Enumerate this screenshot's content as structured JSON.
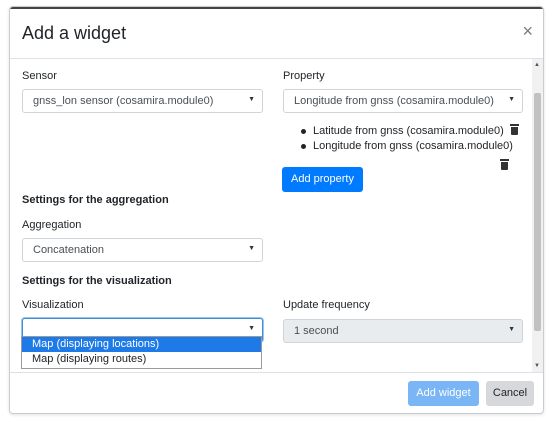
{
  "dialog": {
    "title": "Add a widget",
    "close_icon": "×"
  },
  "sensor": {
    "label": "Sensor",
    "value": "gnss_lon sensor (cosamira.module0)"
  },
  "property": {
    "label": "Property",
    "value": "Longitude from gnss (cosamira.module0)",
    "items": [
      "Latitude from gnss (cosamira.module0)",
      "Longitude from gnss (cosamira.module0)"
    ],
    "add_label": "Add property"
  },
  "aggregation": {
    "heading": "Settings for the aggregation",
    "label": "Aggregation",
    "value": "Concatenation"
  },
  "visualization": {
    "heading": "Settings for the visualization",
    "label": "Visualization",
    "value": "",
    "options": [
      "Map (displaying locations)",
      "Map (displaying routes)"
    ],
    "highlighted": "Map (displaying locations)"
  },
  "update_frequency": {
    "label": "Update frequency",
    "value": "1 second"
  },
  "footer": {
    "add_label": "Add widget",
    "cancel_label": "Cancel"
  },
  "colors": {
    "primary": "#007bff",
    "primary_disabled": "#7ab5f5",
    "secondary": "#d6d8db",
    "dropdown_highlight": "#1e7ae6"
  }
}
